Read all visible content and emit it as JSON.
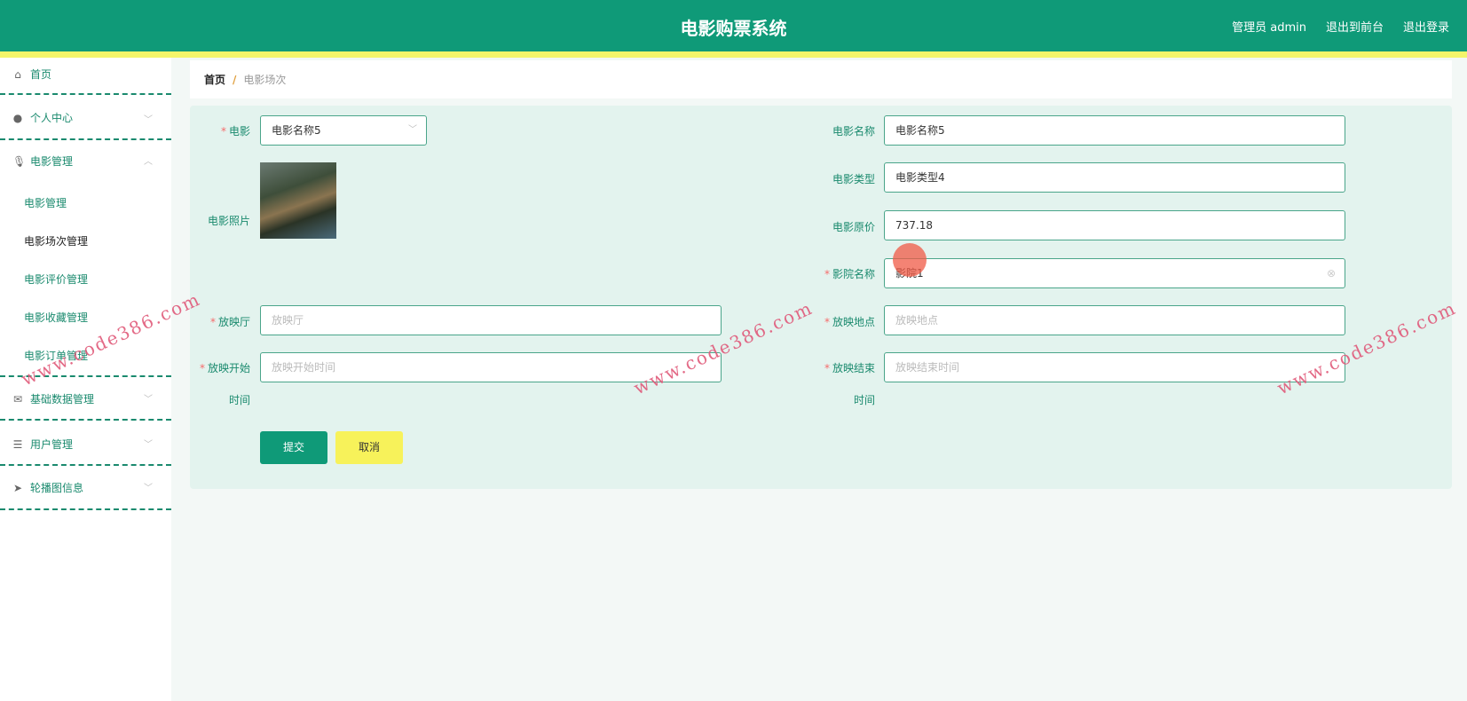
{
  "header": {
    "title": "电影购票系统",
    "user": "管理员 admin",
    "front": "退出到前台",
    "logout": "退出登录"
  },
  "sidebar": {
    "home": "首页",
    "personal": "个人中心",
    "movie_mgmt": "电影管理",
    "subs": [
      "电影管理",
      "电影场次管理",
      "电影评价管理",
      "电影收藏管理",
      "电影订单管理"
    ],
    "basic": "基础数据管理",
    "users": "用户管理",
    "carousel": "轮播图信息"
  },
  "breadcrumb": {
    "home": "首页",
    "sep": "/",
    "current": "电影场次"
  },
  "form": {
    "movie_label": "电影",
    "movie_value": "电影名称5",
    "photo_label": "电影照片",
    "hall_label": "放映厅",
    "hall_placeholder": "放映厅",
    "start_label": "放映开始",
    "start_label2": "时间",
    "start_placeholder": "放映开始时间",
    "name_label": "电影名称",
    "name_value": "电影名称5",
    "type_label": "电影类型",
    "type_value": "电影类型4",
    "price_label": "电影原价",
    "price_value": "737.18",
    "cinema_label": "影院名称",
    "cinema_value": "影院1",
    "place_label": "放映地点",
    "place_placeholder": "放映地点",
    "end_label": "放映结束",
    "end_label2": "时间",
    "end_placeholder": "放映结束时间",
    "submit": "提交",
    "cancel": "取消"
  },
  "watermark": "www.code386.com",
  "colors": {
    "primary": "#0f9a78",
    "accent": "#f4f56a"
  }
}
